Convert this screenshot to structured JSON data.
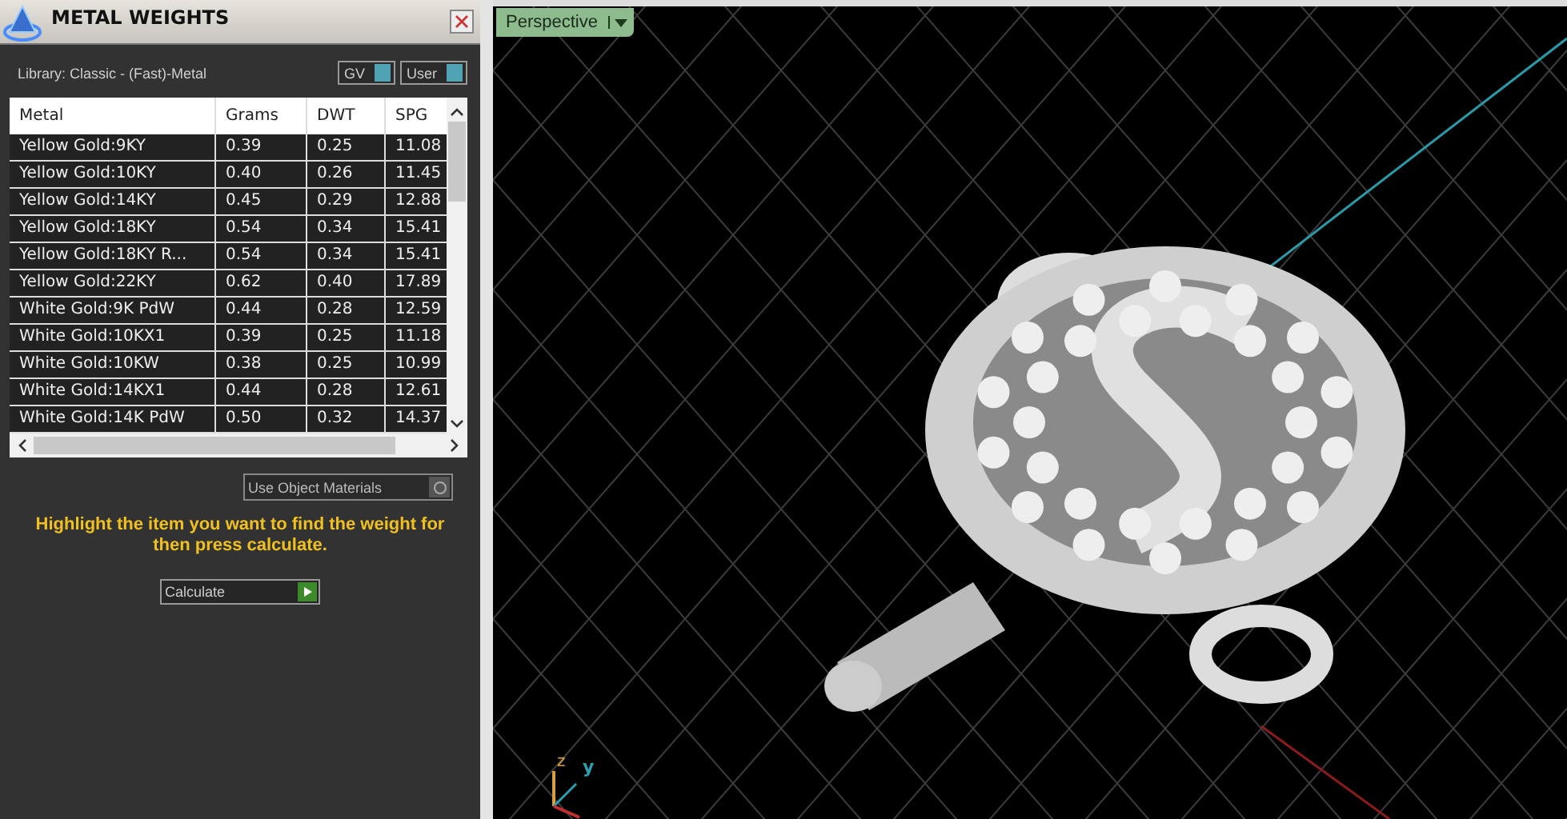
{
  "panel": {
    "title": "METAL WEIGHTS",
    "library": "Library: Classic - (Fast)-Metal",
    "toggles": [
      {
        "label": "GV",
        "on": true
      },
      {
        "label": "User",
        "on": true
      }
    ],
    "table": {
      "columns": [
        "Metal",
        "Grams",
        "DWT",
        "SPG"
      ],
      "rows": [
        {
          "cells": [
            "Yellow Gold:9KY",
            "0.39",
            "0.25",
            "11.08"
          ],
          "selected": false
        },
        {
          "cells": [
            "Yellow Gold:10KY",
            "0.40",
            "0.26",
            "11.45"
          ],
          "selected": false
        },
        {
          "cells": [
            "Yellow Gold:14KY",
            "0.45",
            "0.29",
            "12.88"
          ],
          "selected": false
        },
        {
          "cells": [
            "Yellow Gold:18KY",
            "0.54",
            "0.34",
            "15.41"
          ],
          "selected": false
        },
        {
          "cells": [
            "Yellow Gold:18KY R...",
            "0.54",
            "0.34",
            "15.41"
          ],
          "selected": false
        },
        {
          "cells": [
            "Yellow Gold:22KY",
            "0.62",
            "0.40",
            "17.89"
          ],
          "selected": false
        },
        {
          "cells": [
            "White Gold:9K PdW",
            "0.44",
            "0.28",
            "12.59"
          ],
          "selected": false
        },
        {
          "cells": [
            "White Gold:10KX1",
            "0.39",
            "0.25",
            "11.18"
          ],
          "selected": false
        },
        {
          "cells": [
            "White Gold:10KW",
            "0.38",
            "0.25",
            "10.99"
          ],
          "selected": false
        },
        {
          "cells": [
            "White Gold:14KX1",
            "0.44",
            "0.28",
            "12.61"
          ],
          "selected": false
        },
        {
          "cells": [
            "White Gold:14K PdW",
            "0.50",
            "0.32",
            "14.37"
          ],
          "selected": false
        }
      ]
    },
    "use_object_materials": {
      "label": "Use Object Materials",
      "checked": false
    },
    "hint": "Highlight the item you want to find the weight for then press calculate.",
    "calculate_button": "Calculate"
  },
  "viewport": {
    "view_menu": "Perspective",
    "axes": [
      "z",
      "y"
    ]
  }
}
